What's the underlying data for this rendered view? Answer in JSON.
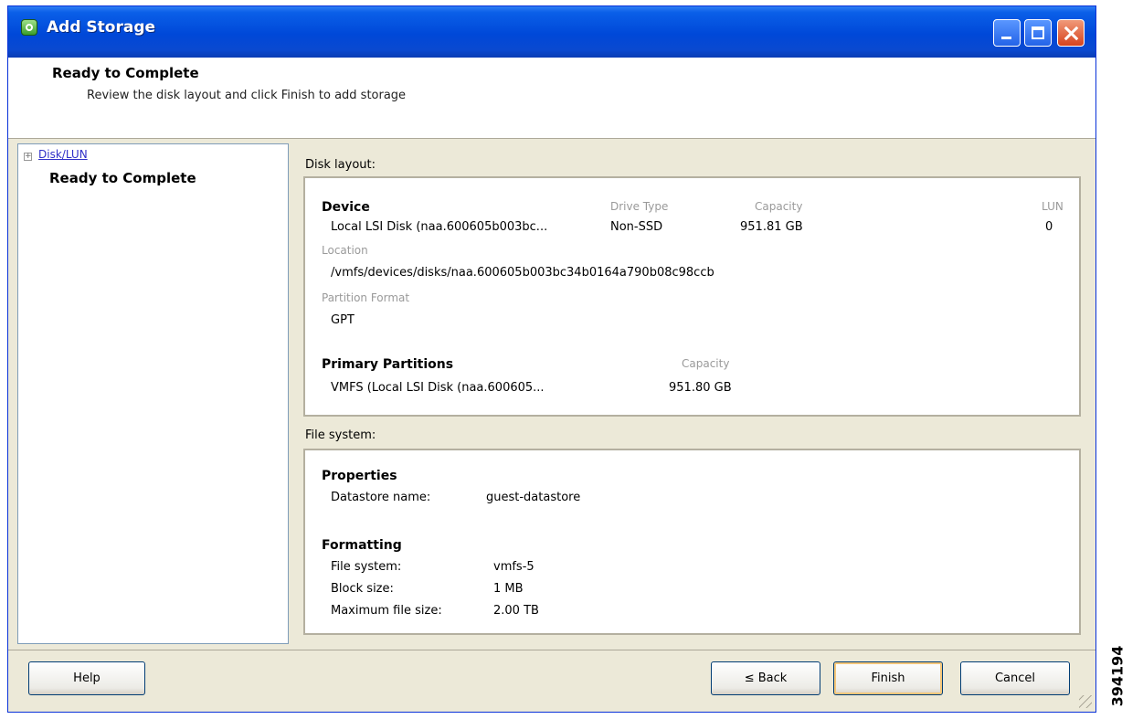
{
  "window": {
    "title": "Add Storage"
  },
  "header": {
    "title": "Ready to Complete",
    "subtitle": "Review the disk layout and click Finish to add storage"
  },
  "nav": {
    "expander": "+",
    "link": "Disk/LUN",
    "current": "Ready to Complete"
  },
  "disk_layout": {
    "label": "Disk layout:",
    "device_heading": "Device",
    "columns": {
      "drive_type": "Drive Type",
      "capacity": "Capacity",
      "lun": "LUN"
    },
    "device_name": "Local LSI Disk (naa.600605b003bc...",
    "drive_type": "Non-SSD",
    "capacity": "951.81 GB",
    "lun": "0",
    "location_label": "Location",
    "location": "/vmfs/devices/disks/naa.600605b003bc34b0164a790b08c98ccb",
    "partition_format_label": "Partition Format",
    "partition_format": "GPT",
    "partitions_heading": "Primary Partitions",
    "partitions_capacity_label": "Capacity",
    "partition_name": "VMFS (Local LSI Disk (naa.600605...",
    "partition_capacity": "951.80 GB"
  },
  "file_system": {
    "label": "File system:",
    "properties_heading": "Properties",
    "datastore_label": "Datastore name:",
    "datastore_value": "guest-datastore",
    "formatting_heading": "Formatting",
    "fs_label": "File system:",
    "fs_value": "vmfs-5",
    "block_label": "Block size:",
    "block_value": "1 MB",
    "maxfile_label": "Maximum file size:",
    "maxfile_value": "2.00 TB"
  },
  "buttons": {
    "help": "Help",
    "back": "≤ Back",
    "finish": "Finish",
    "cancel": "Cancel"
  },
  "side_number": "394194",
  "colors": {
    "titlebar": "#0048d8",
    "window_bg": "#ece9d8",
    "link": "#3030c8"
  }
}
